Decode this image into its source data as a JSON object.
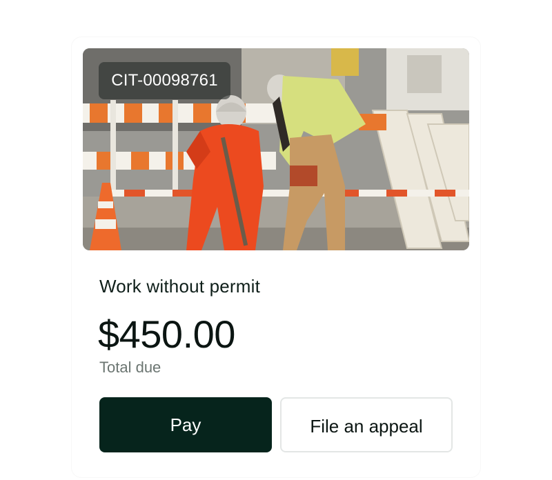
{
  "citation": {
    "id": "CIT-00098761",
    "title": "Work without permit",
    "amount": "$450.00",
    "amount_label": "Total due"
  },
  "actions": {
    "pay_label": "Pay",
    "appeal_label": "File an appeal"
  },
  "colors": {
    "primary_button": "#06241c",
    "text_dark": "#0b1512",
    "text_muted": "#6b7571",
    "secondary_border": "#e3e6e5"
  },
  "image": {
    "subject": "construction workers at street barricades",
    "icon": "construction-photo"
  }
}
